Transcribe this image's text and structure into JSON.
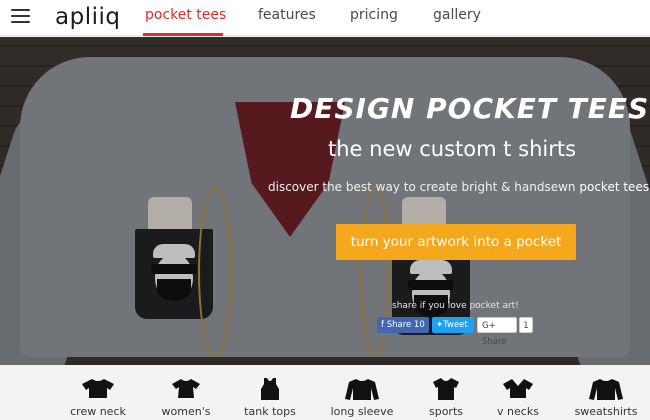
{
  "header": {
    "logo": "apliiq",
    "nav": [
      {
        "label": "pocket tees",
        "active": true
      },
      {
        "label": "features",
        "active": false
      },
      {
        "label": "pricing",
        "active": false
      },
      {
        "label": "gallery",
        "active": false
      }
    ],
    "accent_color": "#d62f2f"
  },
  "hero": {
    "title": "Design pocket tees",
    "subtitle": "the new custom t shirts",
    "description_prefix": "discover the best way to create bright & handsewn",
    "description_highlight": "pocket tees.",
    "cta_label": "turn your artwork into a pocket",
    "cta_color": "#f5a81c",
    "share_text": "share if you love pocket art!",
    "share": {
      "facebook_label": "Share 10",
      "twitter_label": "Tweet",
      "gplus_label": "Share",
      "gplus_count": "1"
    }
  },
  "categories": [
    {
      "label": "crew neck",
      "icon": "crew-neck-shirt-icon"
    },
    {
      "label": "women's",
      "icon": "womens-shirt-icon"
    },
    {
      "label": "tank tops",
      "icon": "tank-top-icon"
    },
    {
      "label": "long sleeve",
      "icon": "long-sleeve-shirt-icon"
    },
    {
      "label": "sports",
      "icon": "sports-jersey-icon"
    },
    {
      "label": "v necks",
      "icon": "v-neck-shirt-icon"
    },
    {
      "label": "sweatshirts",
      "icon": "sweatshirt-icon"
    }
  ]
}
